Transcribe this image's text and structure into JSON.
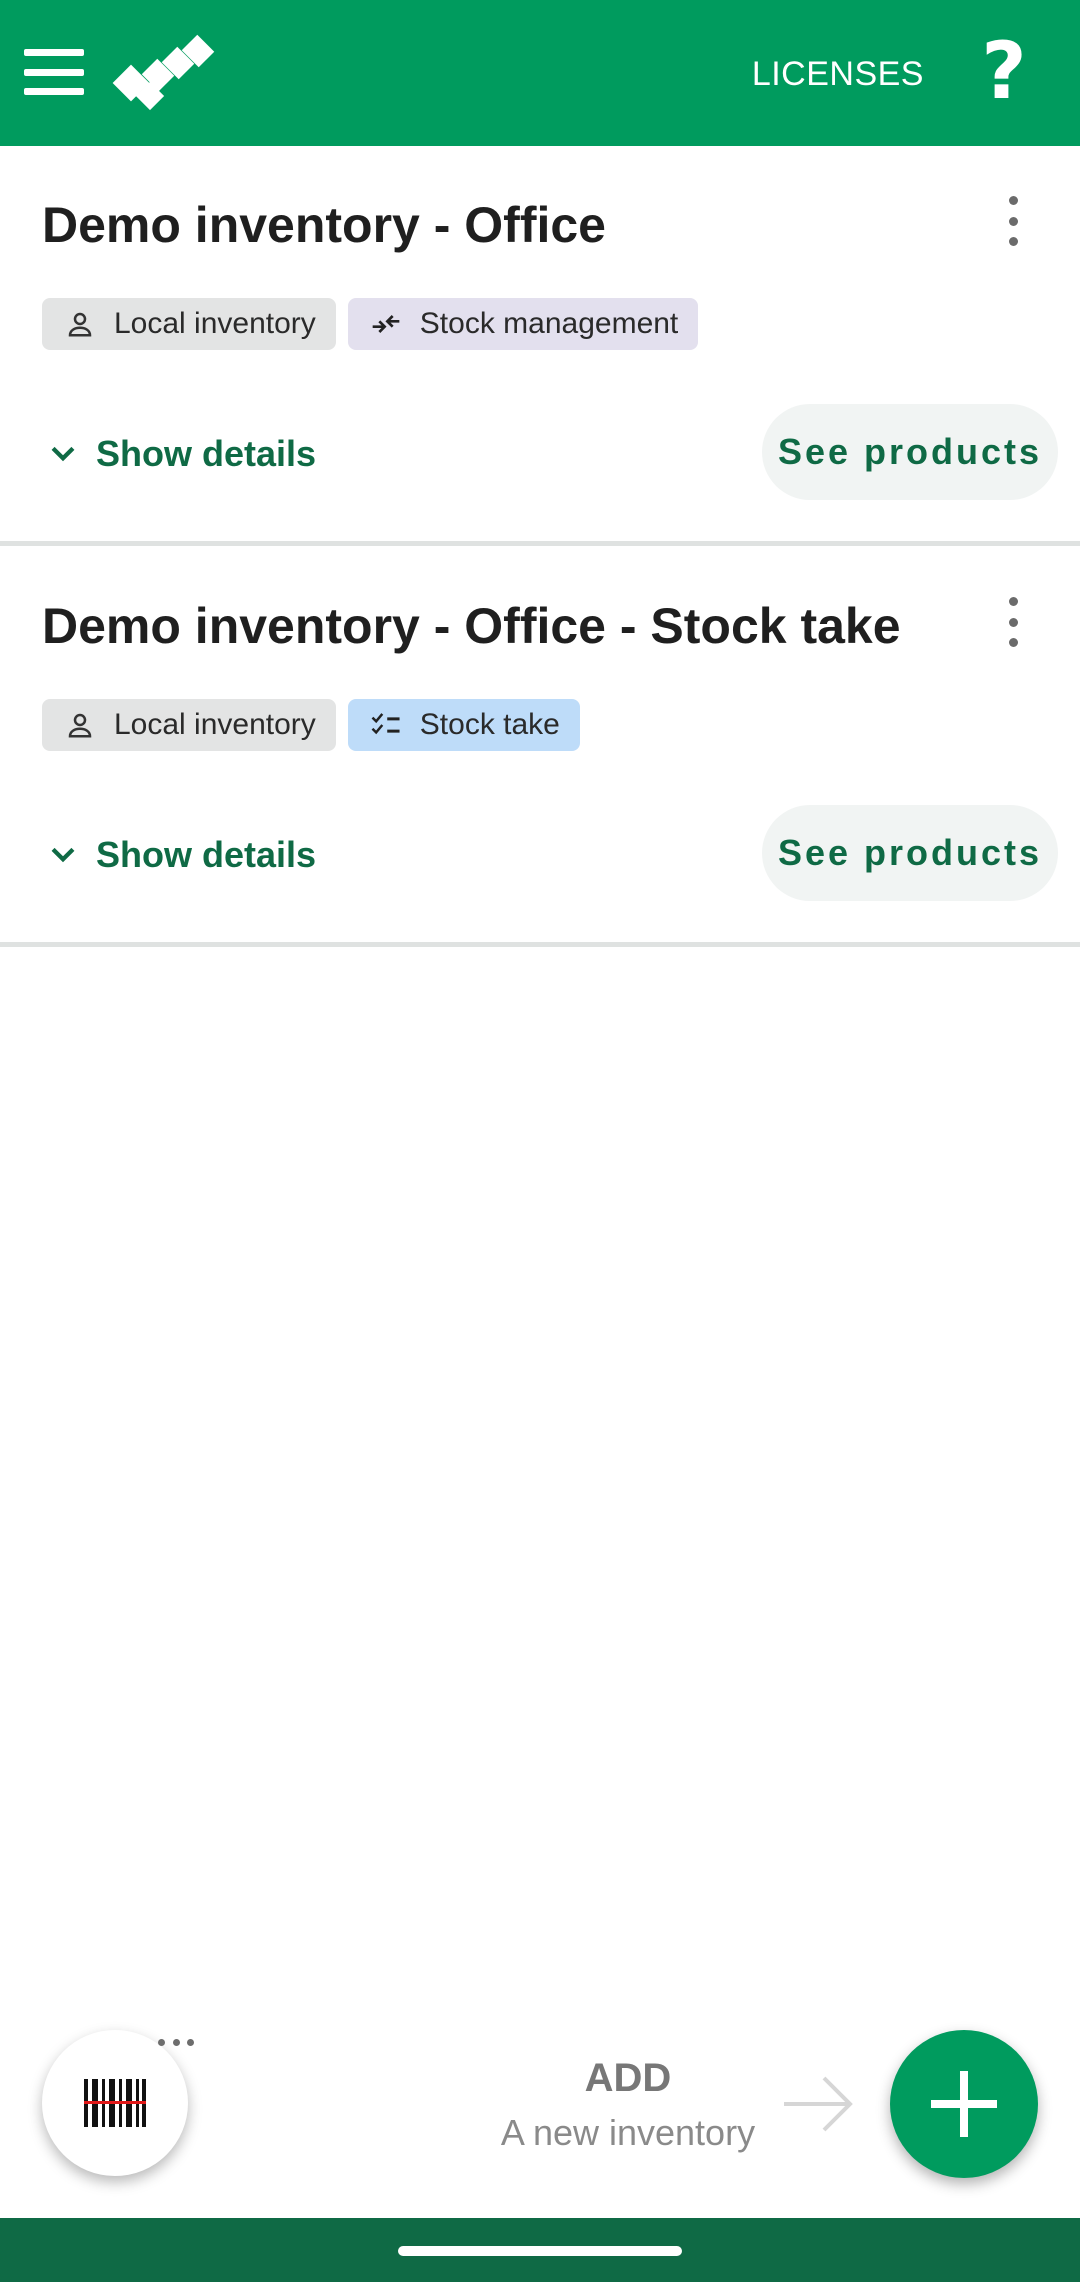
{
  "app_bar": {
    "licenses_label": "LICENSES",
    "help_label": "?",
    "icons": [
      "menu-icon",
      "app-logo-icon",
      "help-icon"
    ]
  },
  "inventories": [
    {
      "title": "Demo inventory - Office",
      "tags": [
        {
          "label": "Local inventory",
          "icon": "person-icon"
        },
        {
          "label": "Stock management",
          "icon": "stock-arrows-icon"
        }
      ],
      "details_label": "Show details",
      "products_label": "See products"
    },
    {
      "title": "Demo inventory - Office - Stock take",
      "tags": [
        {
          "label": "Local inventory",
          "icon": "person-icon"
        },
        {
          "label": "Stock take",
          "icon": "checklist-icon"
        }
      ],
      "details_label": "Show details",
      "products_label": "See products"
    }
  ],
  "bottom": {
    "add_title": "ADD",
    "add_subtitle": "A new inventory",
    "scan_icon": "barcode-scan-icon",
    "add_icon": "plus-icon"
  },
  "colors": {
    "primary": "#009b5e",
    "primary_dark": "#0f6a45",
    "chip_local": "#e3e4e4",
    "chip_stock_management": "#e3e0ee",
    "chip_stock_take": "#bedcf9"
  }
}
